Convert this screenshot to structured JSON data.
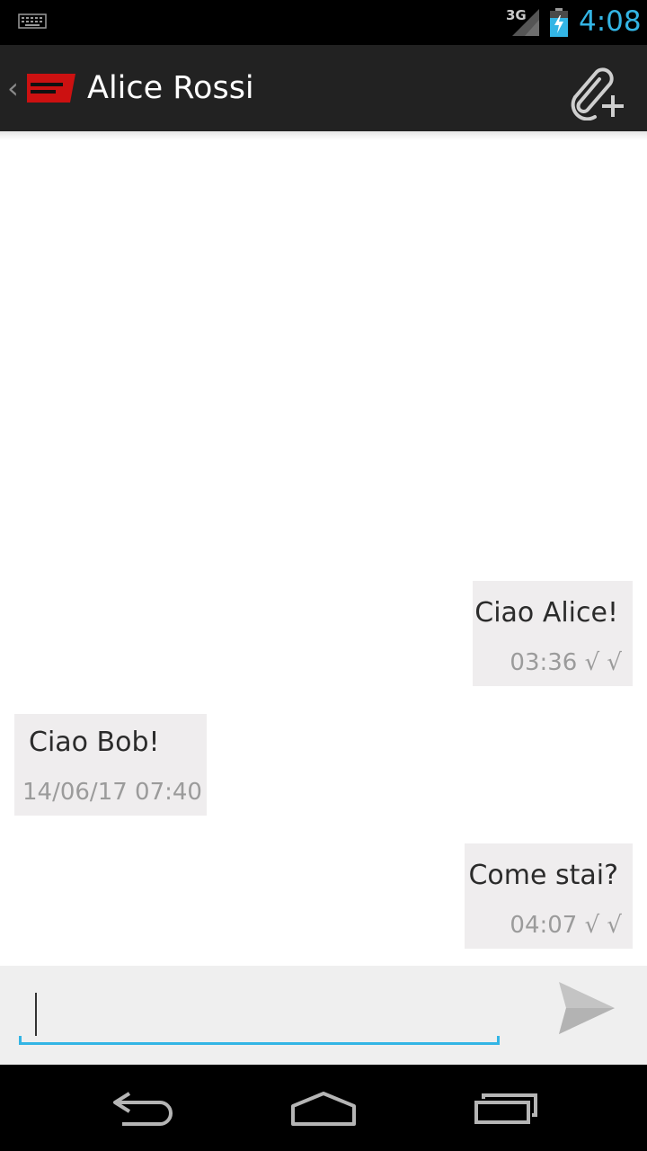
{
  "status_bar": {
    "network_label": "3G",
    "time": "4:08",
    "keyboard_icon": "keyboard-icon",
    "signal_icon": "signal-icon",
    "battery_icon": "battery-charging-icon",
    "accent_color": "#33b5e5"
  },
  "action_bar": {
    "up_icon": "chevron-left-icon",
    "logo_icon": "app-logo-icon",
    "title": "Alice Rossi",
    "attach_icon": "attach-add-icon"
  },
  "messages": [
    {
      "direction": "outgoing",
      "text": "Ciao Alice!",
      "meta": "03:36 √ √"
    },
    {
      "direction": "incoming",
      "text": "Ciao Bob!",
      "meta": "14/06/17 07:40"
    },
    {
      "direction": "outgoing",
      "text": "Come stai?",
      "meta": "04:07 √ √"
    }
  ],
  "compose": {
    "value": "",
    "send_icon": "send-icon"
  },
  "nav_bar": {
    "back_icon": "back-icon",
    "home_icon": "home-icon",
    "recents_icon": "recents-icon"
  },
  "colors": {
    "action_bar_bg": "#222222",
    "bubble_bg": "#efedee",
    "logo_red": "#cc1111",
    "input_underline": "#33b5e5"
  }
}
